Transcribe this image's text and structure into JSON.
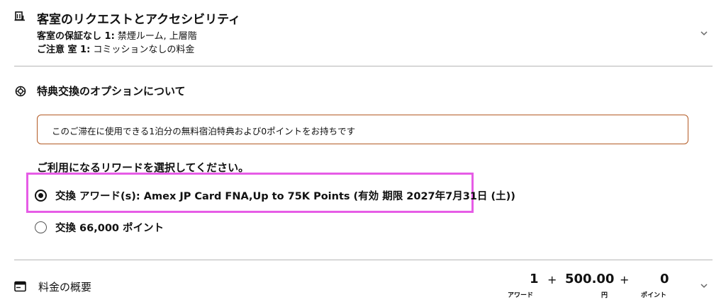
{
  "requests": {
    "icon": "bed-building-icon",
    "title": "客室のリクエストとアクセシビリティ",
    "line1_label": "客室の保証なし 1:",
    "line1_value": " 禁煙ルーム, 上層階",
    "line2_label": "ご注意 室 1:",
    "line2_value": " コミッションなしの料金"
  },
  "reward": {
    "icon": "award-badge-icon",
    "title": "特典交換のオプションについて",
    "info_text": "このご滞在に使用できる1泊分の無料宿泊特典および0ポイントをお持ちです",
    "select_title": "ご利用になるリワードを選択してください。",
    "options": [
      {
        "label": "交換 アワード(s): Amex JP Card FNA,Up to 75K Points (有効 期限 2027年7月31日 (土))",
        "selected": true
      },
      {
        "label": "交換 66,000 ポイント",
        "selected": false
      }
    ],
    "highlight_color": "#e65ce6",
    "box_border_color": "#b35a24"
  },
  "price": {
    "icon": "wallet-icon",
    "title": "料金の概要",
    "awards_value": "1",
    "awards_unit": "アワード",
    "yen_value": "500.00",
    "yen_unit": "円",
    "points_value": "0",
    "points_unit": "ポイント",
    "plus": "+"
  }
}
